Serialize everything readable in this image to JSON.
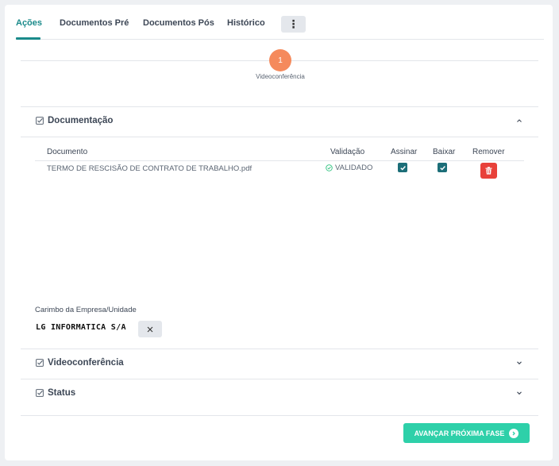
{
  "tabs": [
    {
      "label": "Ações",
      "active": true
    },
    {
      "label": "Documentos Pré",
      "active": false
    },
    {
      "label": "Documentos Pós",
      "active": false
    },
    {
      "label": "Histórico",
      "active": false
    }
  ],
  "more_icon": "⋮",
  "stepper": {
    "number": "1",
    "label": "Videoconferência"
  },
  "sections": {
    "documentacao": {
      "title": "Documentação",
      "expanded": true
    },
    "videoconferencia": {
      "title": "Videoconferência",
      "expanded": false
    },
    "status": {
      "title": "Status",
      "expanded": false
    }
  },
  "table": {
    "headers": {
      "documento": "Documento",
      "validacao": "Validação",
      "assinar": "Assinar",
      "baixar": "Baixar",
      "remover": "Remover"
    },
    "rows": [
      {
        "documento": "TERMO DE RESCISÃO DE CONTRATO DE TRABALHO.pdf",
        "validacao": "VALIDADO",
        "assinar": true,
        "baixar": true
      }
    ]
  },
  "stamp": {
    "label": "Carimbo da Empresa/Unidade",
    "value": "LG INFORMATICA S/A"
  },
  "advance_button": {
    "label": "AVANÇAR PRÓXIMA FASE"
  },
  "colors": {
    "accent": "#1a8a8a",
    "step": "#f58a5c",
    "checkbox": "#1c6e78",
    "danger": "#e8413a",
    "success_button": "#2ed0a9",
    "validated": "#2ec27e"
  }
}
